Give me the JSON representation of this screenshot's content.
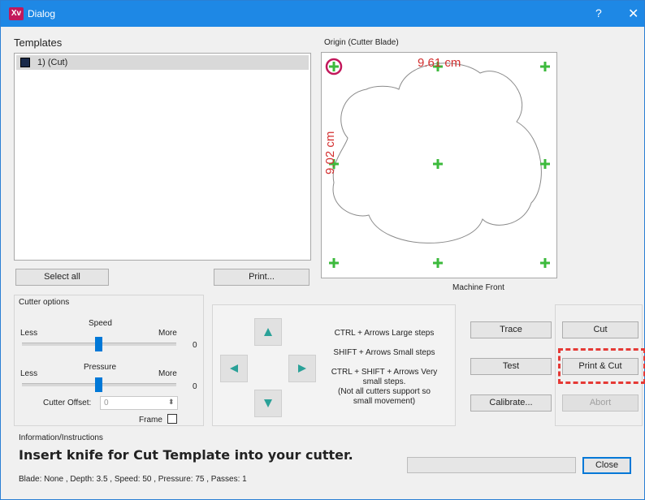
{
  "window": {
    "title": "Dialog",
    "help_glyph": "?",
    "close_glyph": "✕",
    "app_icon_text": "Xv"
  },
  "templates": {
    "label": "Templates",
    "items": [
      {
        "number": "1)",
        "label": "1) (Cut)",
        "swatch_color": "#1a2a4a"
      }
    ],
    "select_all_label": "Select all",
    "print_label": "Print..."
  },
  "preview": {
    "origin_label": "Origin (Cutter Blade)",
    "width_label": "9.61 cm",
    "height_label": "9.02 cm",
    "machine_front_label": "Machine Front",
    "dimension_color": "#d32f2f",
    "marker_color": "#3cba3c",
    "origin_ring_color": "#c2185b"
  },
  "cutter_options": {
    "title": "Cutter options",
    "speed": {
      "label": "Speed",
      "less": "Less",
      "more": "More",
      "value": "0",
      "level": 0.5
    },
    "pressure": {
      "label": "Pressure",
      "less": "Less",
      "more": "More",
      "value": "0",
      "level": 0.5
    },
    "offset_label": "Cutter Offset:",
    "offset_value": "0",
    "frame_label": "Frame",
    "frame_checked": false
  },
  "movement": {
    "icons": [
      "arrow-up-icon",
      "arrow-left-icon",
      "arrow-right-icon",
      "arrow-down-icon"
    ],
    "arrow_color": "#2aa198",
    "help_large": "CTRL + Arrows  Large steps",
    "help_small": "SHIFT + Arrows  Small steps",
    "help_very_small": "CTRL + SHIFT + Arrows  Very small steps.",
    "help_note": "(Not all cutters support so small movement)"
  },
  "actions": {
    "trace": "Trace",
    "test": "Test",
    "calibrate": "Calibrate...",
    "cut": "Cut",
    "print_and_cut": "Print & Cut",
    "abort": "Abort",
    "highlight_color": "#e53935"
  },
  "info": {
    "title": "Information/Instructions",
    "message": "Insert knife for Cut Template into your cutter.",
    "status": "Blade: None ,  Depth:  3.5 , Speed: 50 , Pressure: 75 , Passes: 1",
    "close_label": "Close"
  }
}
